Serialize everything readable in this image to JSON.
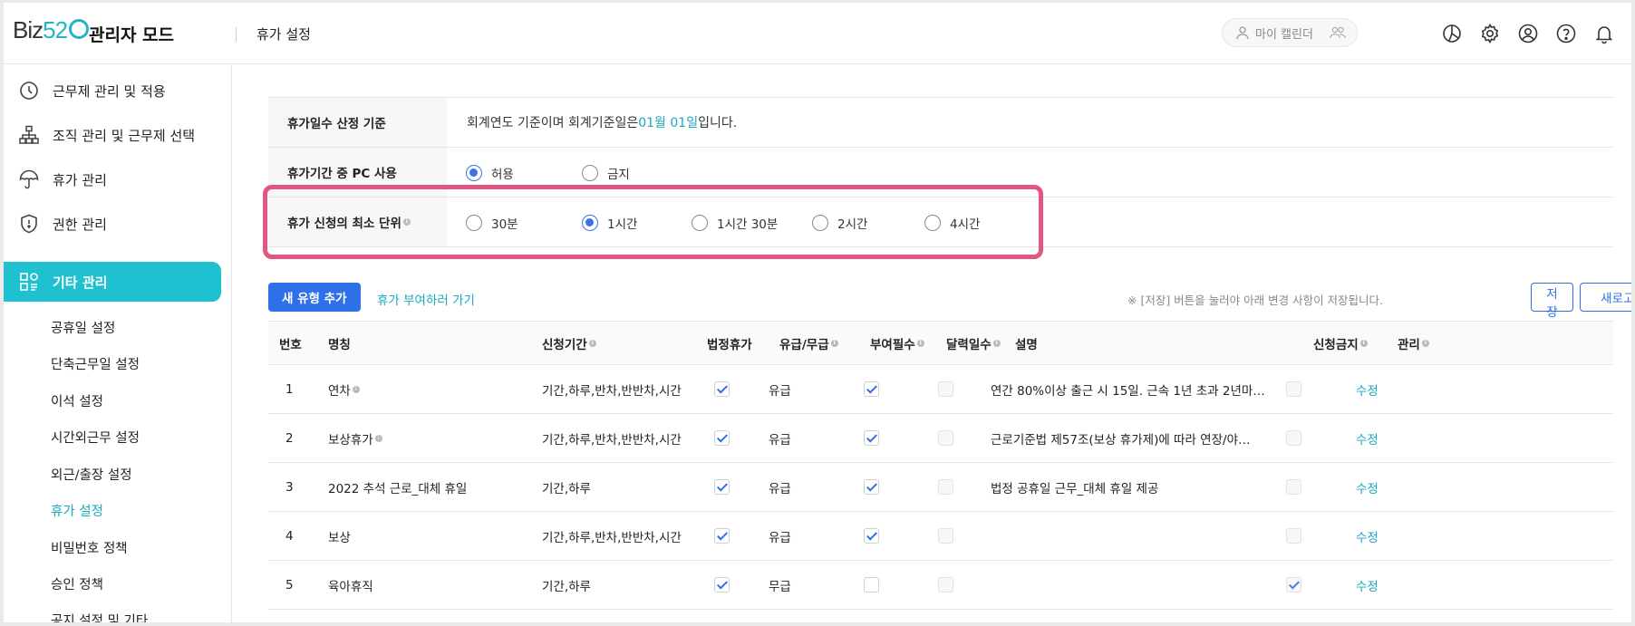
{
  "header": {
    "logo_text": "Biz",
    "logo_num": "52",
    "admin_title": "관리자 모드",
    "page_crumb": "휴가 설정",
    "calendar_label": "마이 캘린더"
  },
  "sidebar": {
    "items": [
      {
        "label": "근무제 관리 및 적용",
        "icon": "clock-icon"
      },
      {
        "label": "조직 관리 및 근무제 선택",
        "icon": "org-chart-icon"
      },
      {
        "label": "휴가 관리",
        "icon": "umbrella-icon"
      },
      {
        "label": "권한 관리",
        "icon": "shield-icon"
      },
      {
        "label": "기타 관리",
        "icon": "grid-icon"
      }
    ],
    "sub_items": [
      {
        "label": "공휴일 설정"
      },
      {
        "label": "단축근무일 설정"
      },
      {
        "label": "이석 설정"
      },
      {
        "label": "시간외근무 설정"
      },
      {
        "label": "외근/출장 설정"
      },
      {
        "label": "휴가 설정"
      },
      {
        "label": "비밀번호 정책"
      },
      {
        "label": "승인 정책"
      },
      {
        "label": "공지 설정 및 기타"
      }
    ]
  },
  "settings": {
    "row1_label": "휴가일수 산정 기준",
    "row1_text_before": "회계연도 기준이며 회계기준일은 ",
    "row1_highlight": "01월 01일",
    "row1_text_after": " 입니다.",
    "row2_label": "휴가기간 중 PC 사용",
    "row2_options": [
      "허용",
      "금지"
    ],
    "row2_selected": "허용",
    "row3_label": "휴가 신청의 최소 단위",
    "row3_options": [
      "30분",
      "1시간",
      "1시간 30분",
      "2시간",
      "4시간"
    ],
    "row3_selected": "1시간"
  },
  "toolbar": {
    "add_label": "새 유형 추가",
    "grant_link": "휴가 부여하러 가기",
    "notice": "※ [저장] 버튼을 눌러야 아래 변경 사항이 저장됩니다.",
    "save_label": "저장",
    "refresh_label": "새로고침"
  },
  "table": {
    "headers": {
      "no": "번호",
      "name": "명칭",
      "period": "신청기간",
      "legal": "법정휴가",
      "paid": "유급/무급",
      "mandatory": "부여필수",
      "calendar_days": "달력일수",
      "desc": "설명",
      "blocked": "신청금지",
      "manage": "관리"
    },
    "edit_label": "수정",
    "rows": [
      {
        "no": "1",
        "name": "연차",
        "name_info": true,
        "period": "기간,하루,반차,반반차,시간",
        "legal": true,
        "paid": "유급",
        "mandatory": true,
        "calendar_days": false,
        "desc": "연간 80%이상 출근 시 15일. 근속 1년 초과 2년마…",
        "blocked": false
      },
      {
        "no": "2",
        "name": "보상휴가",
        "name_info": true,
        "period": "기간,하루,반차,반반차,시간",
        "legal": true,
        "paid": "유급",
        "mandatory": true,
        "calendar_days": false,
        "desc": "근로기준법 제57조(보상 휴가제)에 따라 연장/야…",
        "blocked": false
      },
      {
        "no": "3",
        "name": "2022 추석 근로_대체 휴일",
        "name_info": false,
        "period": "기간,하루",
        "legal": true,
        "paid": "유급",
        "mandatory": true,
        "calendar_days": false,
        "desc": "법정 공휴일 근무_대체 휴일 제공",
        "blocked": false
      },
      {
        "no": "4",
        "name": "보상",
        "name_info": false,
        "period": "기간,하루,반차,반반차,시간",
        "legal": true,
        "paid": "유급",
        "mandatory": true,
        "calendar_days": false,
        "desc": "",
        "blocked": false
      },
      {
        "no": "5",
        "name": "육아휴직",
        "name_info": false,
        "period": "기간,하루",
        "legal": true,
        "paid": "무급",
        "mandatory": false,
        "calendar_days": false,
        "desc": "",
        "blocked": true
      }
    ]
  },
  "colors": {
    "accent": "#1fc0cf",
    "primary": "#2f6fe8",
    "highlight_border": "#e2577f"
  }
}
